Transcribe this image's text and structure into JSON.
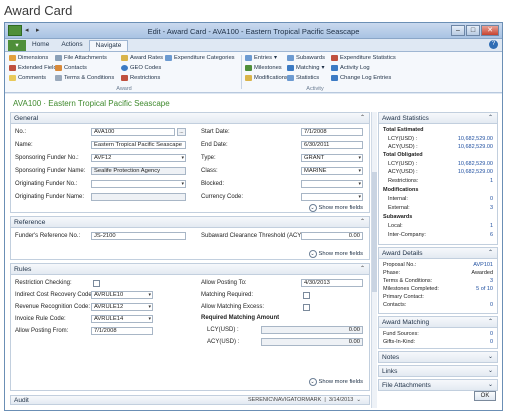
{
  "page_title": "Award Card",
  "window": {
    "title": "Edit - Award Card - AVA100 - Eastern Tropical Pacific Seascape",
    "buttons": {
      "minimize": "–",
      "maximize": "□",
      "close": "✕"
    }
  },
  "tabs": [
    "Home",
    "Actions",
    "Navigate"
  ],
  "active_tab": "Navigate",
  "ribbon": {
    "award_group": {
      "caption": "Award",
      "items": [
        "Dimensions",
        "File Attachments",
        "Award Rates",
        "Expenditure Categories",
        "Extended Fields",
        "Contacts",
        "GEO Codes",
        "Comments",
        "Terms & Conditions",
        "Restrictions"
      ]
    },
    "activity_group": {
      "caption": "Activity",
      "items": [
        "Entries",
        "Subawards",
        "Expenditure Statistics",
        "Milestones",
        "Matching",
        "Activity Log",
        "Modifications",
        "Statistics",
        "Change Log Entries"
      ]
    }
  },
  "record_title": "AVA100 · Eastern Tropical Pacific Seascape",
  "general": {
    "header": "General",
    "fields": {
      "no_label": "No.:",
      "no_value": "AVA100",
      "no_btn": "...",
      "name_label": "Name:",
      "name_value": "Eastern Tropical Pacific Seascape",
      "sponsoring_no_label": "Sponsoring Funder No.:",
      "sponsoring_no_value": "AVF12",
      "sponsoring_name_label": "Sponsoring Funder Name:",
      "sponsoring_name_value": "Sealife Protection Agency",
      "originating_no_label": "Originating Funder No.:",
      "originating_no_value": "",
      "originating_name_label": "Originating Funder Name:",
      "originating_name_value": "",
      "start_label": "Start Date:",
      "start_value": "7/1/2008",
      "end_label": "End Date:",
      "end_value": "6/30/2011",
      "type_label": "Type:",
      "type_value": "GRANT",
      "class_label": "Class:",
      "class_value": "MARINE",
      "blocked_label": "Blocked:",
      "blocked_value": "",
      "currency_label": "Currency Code:",
      "currency_value": ""
    },
    "show_more": "Show more fields"
  },
  "reference": {
    "header": "Reference",
    "funders_ref_label": "Funder's Reference No.:",
    "funders_ref_value": "JS-2100",
    "threshold_label": "Subaward Clearance Threshold (ACY):",
    "threshold_value": "0.00",
    "show_more": "Show more fields"
  },
  "rules": {
    "header": "Rules",
    "restriction_label": "Restriction Checking:",
    "indirect_label": "Indirect Cost Recovery Code:",
    "indirect_value": "AVRULE10",
    "revenue_label": "Revenue Recognition Code:",
    "revenue_value": "AVRULE12",
    "invoice_label": "Invoice Rule Code:",
    "invoice_value": "AVRULE14",
    "allow_from_label": "Allow Posting From:",
    "allow_from_value": "7/1/2008",
    "allow_to_label": "Allow Posting To:",
    "allow_to_value": "4/30/2013",
    "matching_req_label": "Matching Required:",
    "allow_excess_label": "Allow Matching Excess:",
    "req_matching_header": "Required Matching Amount",
    "lcy_label": "LCY(USD) :",
    "lcy_value": "0.00",
    "acy_label": "ACY(USD) :",
    "acy_value": "0.00",
    "show_more": "Show more fields"
  },
  "audit": {
    "header": "Audit",
    "user": "SERENIC\\NAVIGATORMARK",
    "date": "3/14/2013"
  },
  "factbox": {
    "award_statistics": {
      "header": "Award Statistics",
      "total_estimated": "Total Estimated",
      "lcy_label": "LCY(USD) :",
      "est_lcy": "10,682,529.00",
      "acy_label": "ACY(USD) :",
      "est_acy": "10,682,529.00",
      "total_obligated": "Total Obligated",
      "obl_lcy": "10,682,529.00",
      "obl_acy": "10,682,529.00",
      "restrictions_label": "Restrictions:",
      "restrictions_value": "1",
      "modifications": "Modifications",
      "internal_label": "Internal:",
      "internal_value": "0",
      "external_label": "External:",
      "external_value": "3",
      "subawards": "Subawards",
      "local_label": "Local:",
      "local_value": "1",
      "intercompany_label": "Inter-Company:",
      "intercompany_value": "6"
    },
    "award_details": {
      "header": "Award Details",
      "proposal_label": "Proposal No.:",
      "proposal_value": "AVP101",
      "phase_label": "Phase:",
      "phase_value": "Awarded",
      "terms_label": "Terms & Conditions:",
      "terms_value": "3",
      "milestones_label": "Milestones Completed:",
      "milestones_value": "5 of 10",
      "primary_label": "Primary Contact:",
      "primary_value": "",
      "contacts_label": "Contacts:",
      "contacts_value": "0"
    },
    "award_matching": {
      "header": "Award Matching",
      "fund_label": "Fund Sources:",
      "fund_value": "0",
      "gifts_label": "Gifts-In-Kind:",
      "gifts_value": "0"
    },
    "notes": "Notes",
    "links": "Links",
    "file_attachments": "File Attachments"
  },
  "ok_label": "OK",
  "colors": {
    "accent_green": "#3f8a2d",
    "link_blue": "#1f4fa0",
    "ribbon_bg": "#f5f8fc"
  }
}
